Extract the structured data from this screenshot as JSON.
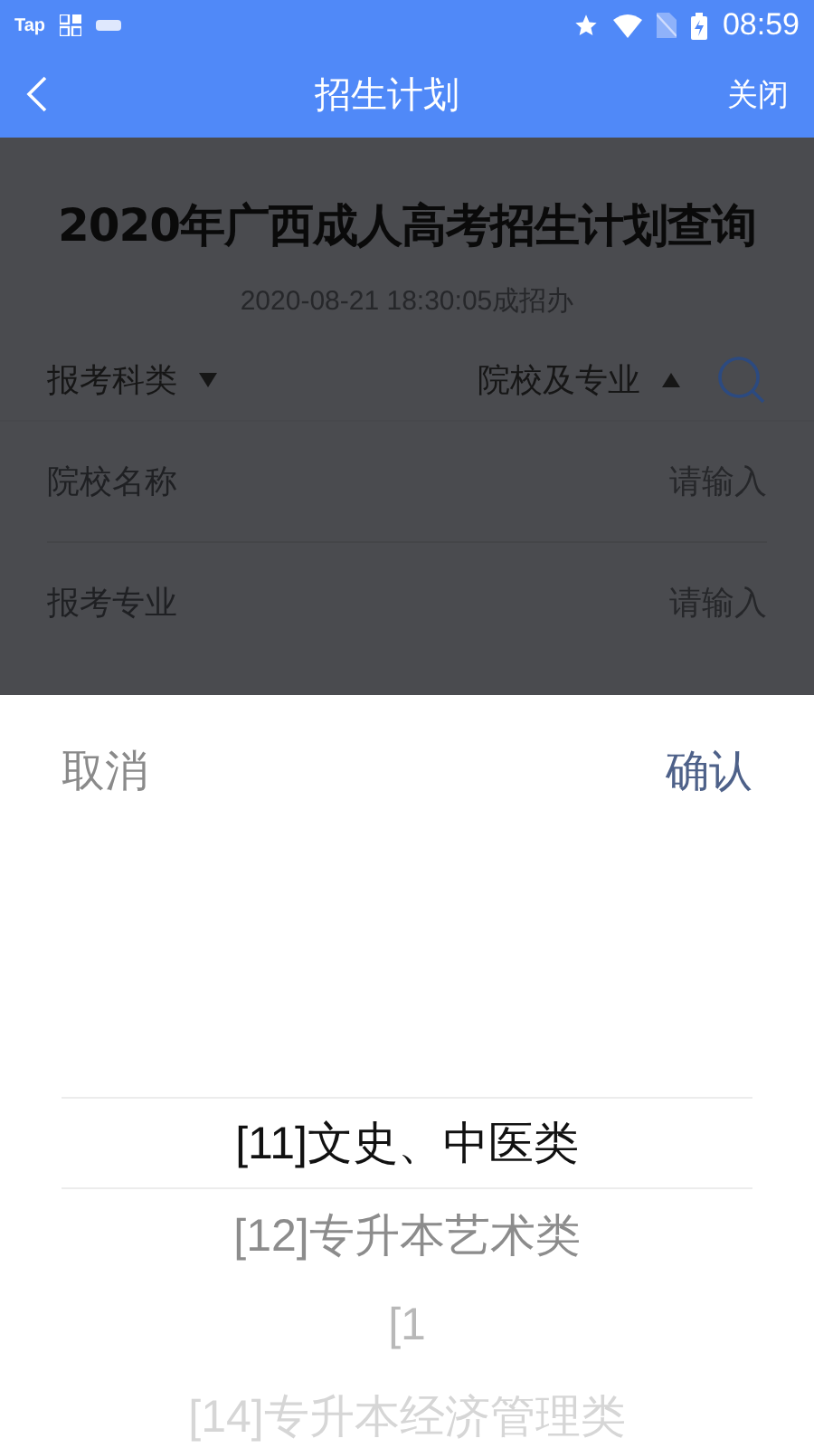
{
  "status_bar": {
    "app_label": "Tap",
    "time": "08:59"
  },
  "nav": {
    "title": "招生计划",
    "close": "关闭"
  },
  "page": {
    "title": "2020年广西成人高考招生计划查询",
    "meta": "2020-08-21 18:30:05成招办"
  },
  "filters": [
    {
      "label": "报考科类",
      "expanded": false
    },
    {
      "label": "院校及专业",
      "expanded": true
    }
  ],
  "fields": [
    {
      "label": "院校名称",
      "placeholder": "请输入"
    },
    {
      "label": "报考专业",
      "placeholder": "请输入"
    }
  ],
  "picker": {
    "cancel": "取消",
    "confirm": "确认",
    "options": [
      {
        "label": "[11]文史、中医类",
        "selected": true
      },
      {
        "label": "[12]专升本艺术类",
        "selected": false
      },
      {
        "label": "[1",
        "selected": false
      },
      {
        "label": "[14]专升本经济管理类",
        "selected": false
      }
    ]
  }
}
